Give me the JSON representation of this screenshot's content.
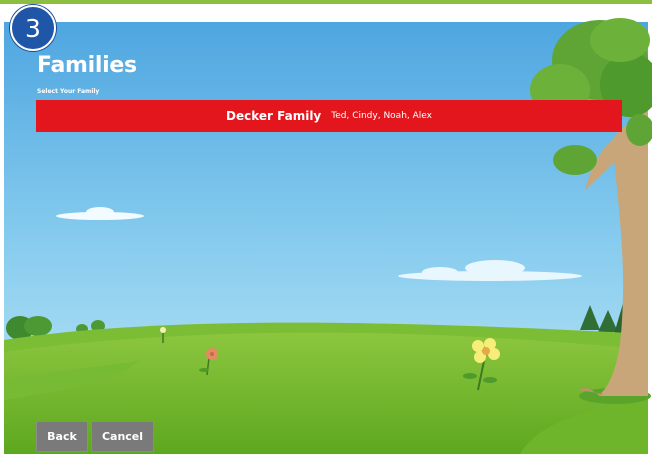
{
  "step": {
    "number": "3"
  },
  "header": {
    "title": "Families",
    "subtitle": "Select Your Family"
  },
  "families": [
    {
      "name": "Decker Family",
      "members": "Ted, Cindy, Noah, Alex"
    }
  ],
  "footer": {
    "back_label": "Back",
    "cancel_label": "Cancel"
  },
  "colors": {
    "accent_green": "#8cbf3f",
    "badge_blue": "#1f56a8",
    "family_red": "#e3151d",
    "button_gray": "#7a7a7a"
  }
}
